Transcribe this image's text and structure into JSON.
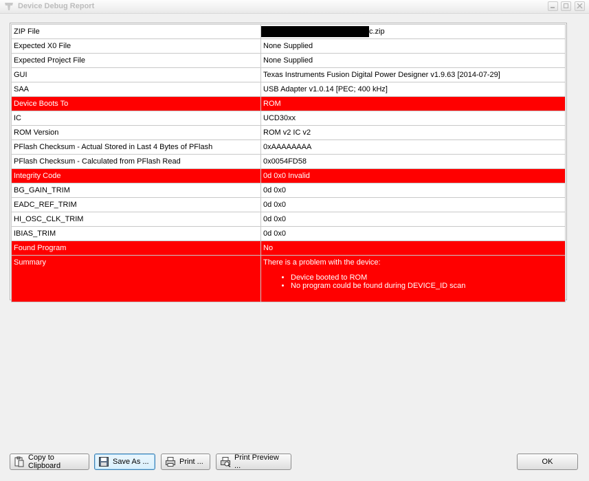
{
  "window": {
    "title": "Device Debug Report",
    "controls": [
      "minimize",
      "maximize",
      "close"
    ]
  },
  "colors": {
    "error_row": "#ff0000",
    "error_text": "#ffffff"
  },
  "report": {
    "rows": [
      {
        "key": "ZIP File",
        "value": "c.zip",
        "redacted_prefix": true,
        "error": false
      },
      {
        "key": "Expected X0 File",
        "value": "None Supplied",
        "error": false
      },
      {
        "key": "Expected Project File",
        "value": "None Supplied",
        "error": false
      },
      {
        "key": "GUI",
        "value": "Texas Instruments Fusion Digital Power Designer v1.9.63 [2014-07-29]",
        "error": false
      },
      {
        "key": "SAA",
        "value": "USB Adapter v1.0.14 [PEC; 400 kHz]",
        "error": false
      },
      {
        "key": "Device Boots To",
        "value": "ROM",
        "error": true
      },
      {
        "key": "IC",
        "value": "UCD30xx",
        "error": false
      },
      {
        "key": "ROM Version",
        "value": "ROM v2 IC v2",
        "error": false
      },
      {
        "key": "PFlash Checksum - Actual Stored in Last 4 Bytes of PFlash",
        "value": "0xAAAAAAAA",
        "error": false
      },
      {
        "key": "PFlash Checksum - Calculated from PFlash Read",
        "value": "0x0054FD58",
        "error": false
      },
      {
        "key": "Integrity Code",
        "value": "0d 0x0 Invalid",
        "error": true
      },
      {
        "key": "BG_GAIN_TRIM",
        "value": "0d 0x0",
        "error": false
      },
      {
        "key": "EADC_REF_TRIM",
        "value": "0d 0x0",
        "error": false
      },
      {
        "key": "HI_OSC_CLK_TRIM",
        "value": "0d 0x0",
        "error": false
      },
      {
        "key": "IBIAS_TRIM",
        "value": "0d 0x0",
        "error": false
      },
      {
        "key": "Found Program",
        "value": "No",
        "error": true
      }
    ],
    "summary": {
      "key": "Summary",
      "intro": "There is a problem with the device:",
      "items": [
        "Device booted to ROM",
        "No program could be found during DEVICE_ID scan"
      ]
    }
  },
  "buttons": {
    "copy": {
      "label": "Copy to Clipboard",
      "icon": "clipboard-icon"
    },
    "save": {
      "label": "Save As ...",
      "icon": "floppy-disk-icon"
    },
    "print": {
      "label": "Print ...",
      "icon": "printer-icon"
    },
    "preview": {
      "label": "Print Preview ...",
      "icon": "print-preview-icon"
    },
    "ok": {
      "label": "OK"
    }
  }
}
